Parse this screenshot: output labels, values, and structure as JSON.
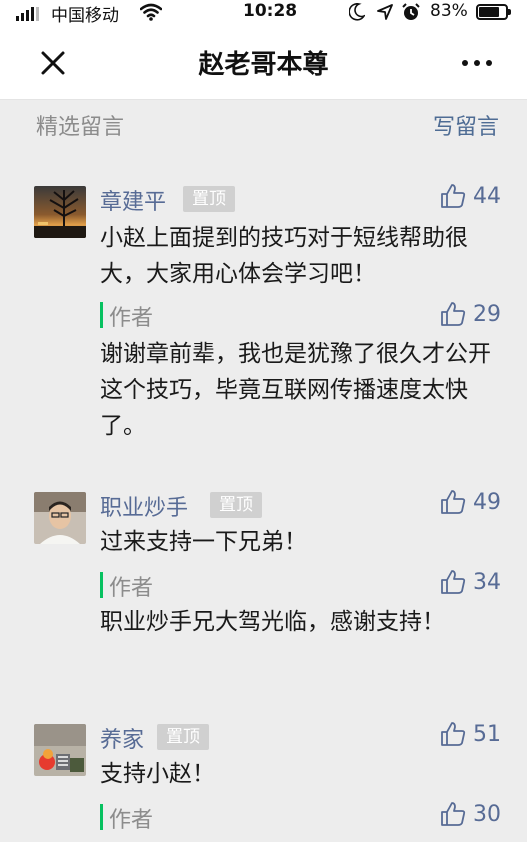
{
  "status_bar": {
    "carrier": "中国移动",
    "time": "10:28",
    "battery_percent": "83%",
    "battery_level": 0.83
  },
  "nav": {
    "title": "赵老哥本尊"
  },
  "section": {
    "label": "精选留言",
    "write_label": "写留言"
  },
  "comments": [
    {
      "name": "章建平",
      "pinned": "置顶",
      "likes": "44",
      "text": "小赵上面提到的技巧对于短线帮助很大，大家用心体会学习吧！",
      "reply_label": "作者",
      "reply_likes": "29",
      "reply": "谢谢章前辈，我也是犹豫了很久才公开这个技巧，毕竟互联网传播速度太快了。"
    },
    {
      "name": "职业炒手",
      "pinned": "置顶",
      "likes": "49",
      "text": "过来支持一下兄弟！",
      "reply_label": "作者",
      "reply_likes": "34",
      "reply": "职业炒手兄大驾光临，感谢支持！"
    },
    {
      "name": "养家",
      "pinned": "置顶",
      "likes": "51",
      "text": "支持小赵！",
      "reply_label": "作者",
      "reply_likes": "30"
    }
  ]
}
